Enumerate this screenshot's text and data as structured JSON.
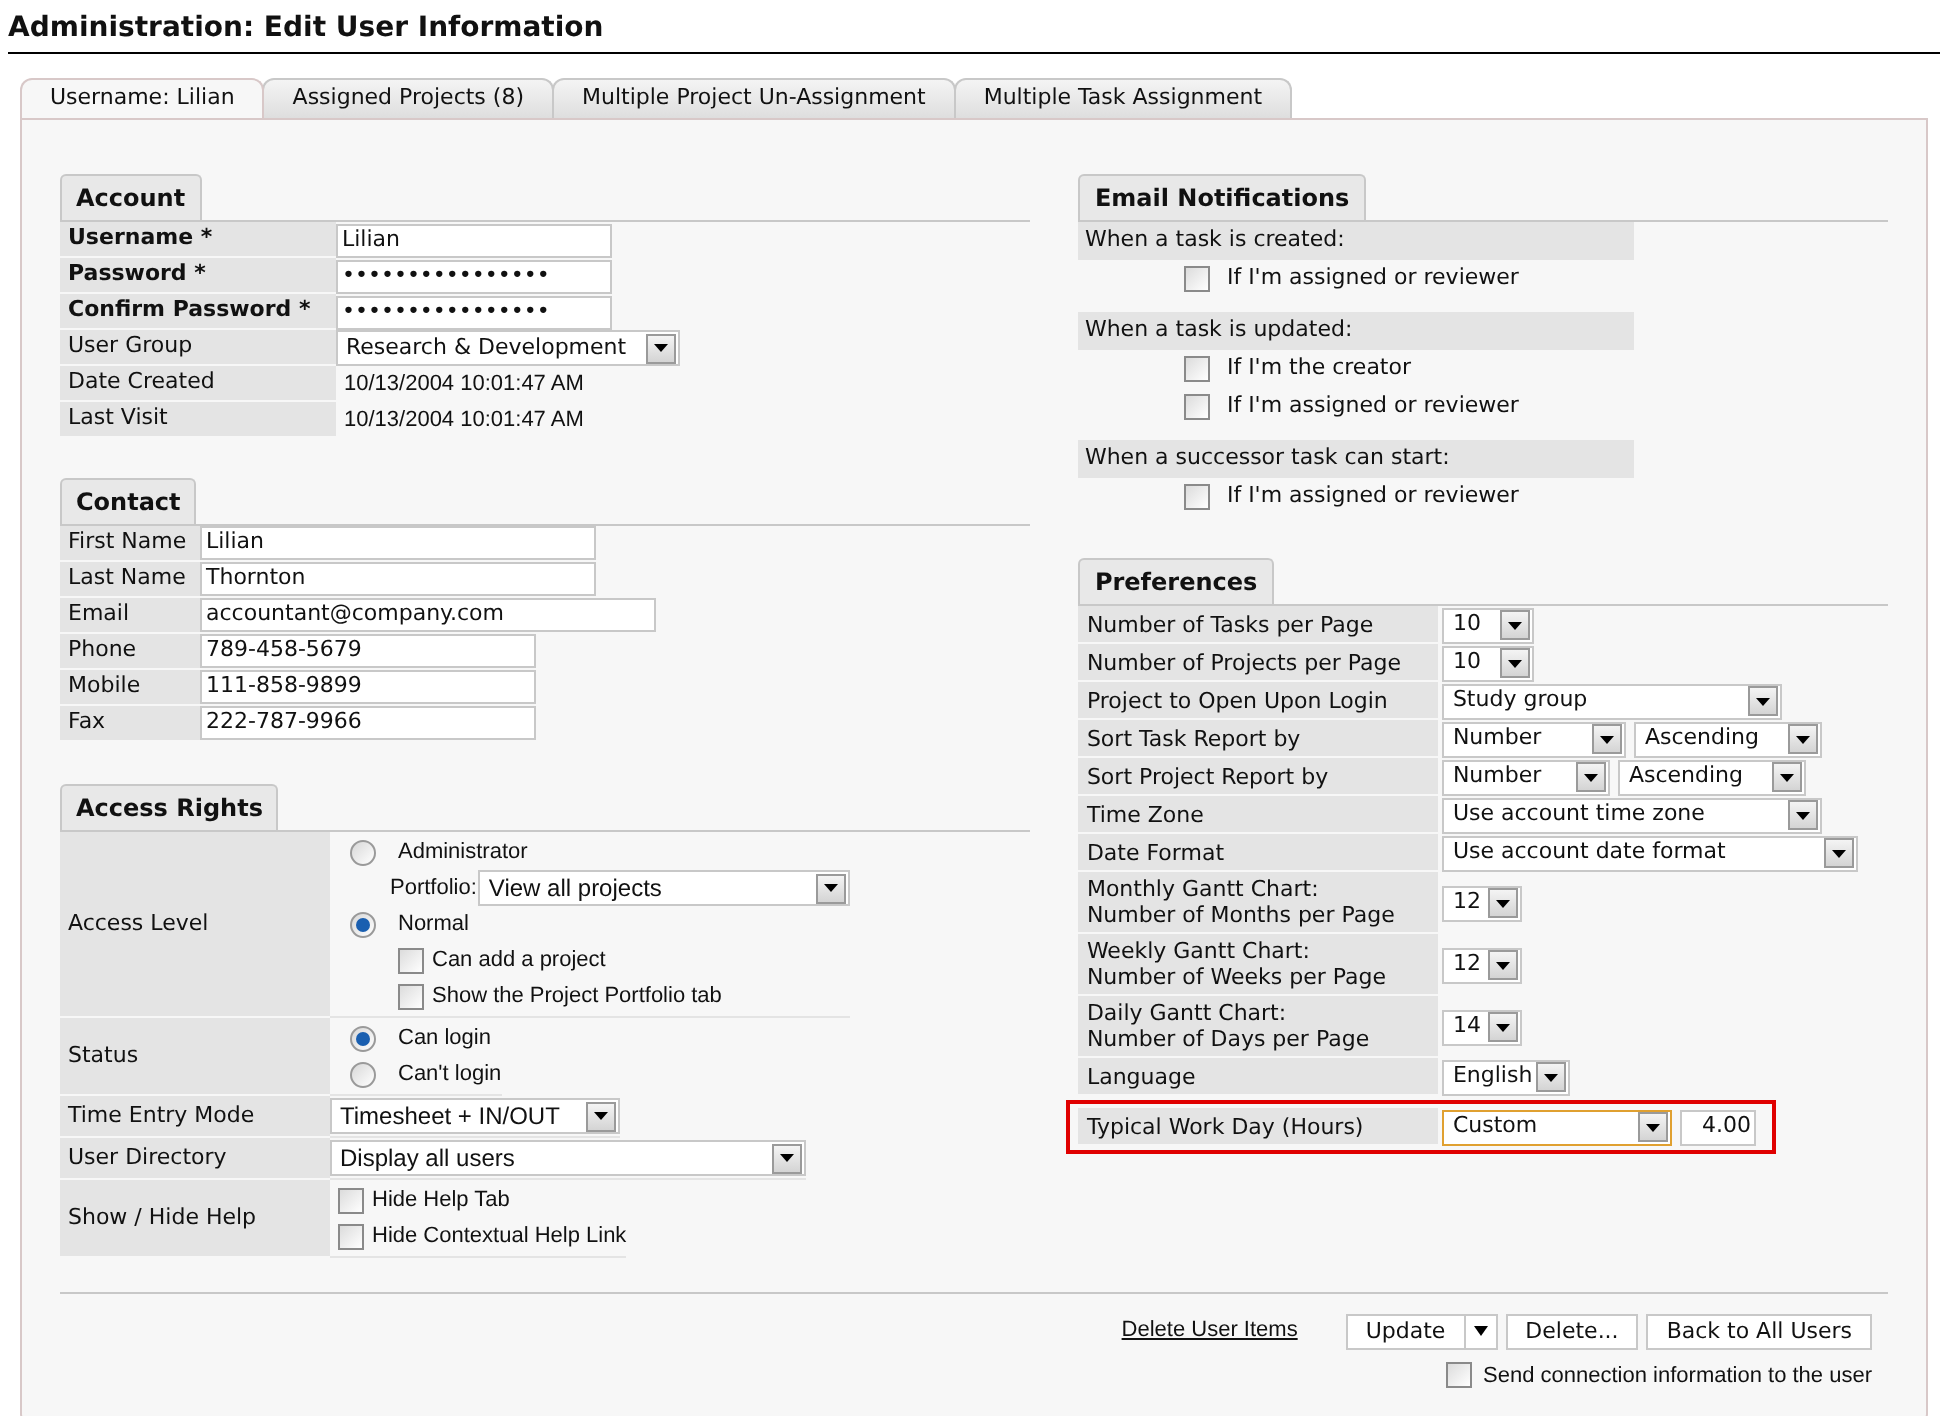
{
  "title": "Administration: Edit User Information",
  "tabs": [
    {
      "label": "Username: Lilian",
      "selected": true
    },
    {
      "label": "Assigned Projects (8)",
      "selected": false
    },
    {
      "label": "Multiple Project Un-Assignment",
      "selected": false
    },
    {
      "label": "Multiple Task Assignment",
      "selected": false
    }
  ],
  "account": {
    "heading": "Account",
    "rows": [
      {
        "label": "Username *",
        "required": true,
        "kind": "input",
        "value": "Lilian"
      },
      {
        "label": "Password *",
        "required": true,
        "kind": "input",
        "value": "••••••••••••••••"
      },
      {
        "label": "Confirm Password *",
        "required": true,
        "kind": "input",
        "value": "••••••••••••••••"
      },
      {
        "label": "User Group",
        "required": false,
        "kind": "select",
        "value": "Research & Development"
      },
      {
        "label": "Date Created",
        "required": false,
        "kind": "static",
        "value": "10/13/2004 10:01:47 AM"
      },
      {
        "label": "Last Visit",
        "required": false,
        "kind": "static",
        "value": "10/13/2004 10:01:47 AM"
      }
    ]
  },
  "contact": {
    "heading": "Contact",
    "rows": [
      {
        "label": "First Name",
        "value": "Lilian"
      },
      {
        "label": "Last Name",
        "value": "Thornton"
      },
      {
        "label": "Email",
        "value": "accountant@company.com"
      },
      {
        "label": "Phone",
        "value": "789-458-5679"
      },
      {
        "label": "Mobile",
        "value": "111-858-9899"
      },
      {
        "label": "Fax",
        "value": "222-787-9966"
      }
    ]
  },
  "access_rights": {
    "heading": "Access Rights",
    "rows": [
      {
        "label": "Access Level",
        "items": [
          {
            "kind": "radio",
            "label": "Administrator",
            "selected": false,
            "children": [
              {
                "kind": "labeled_select",
                "label": "Portfolio:",
                "value": "View all projects"
              }
            ]
          },
          {
            "kind": "radio",
            "label": "Normal",
            "selected": true,
            "children": [
              {
                "kind": "checkbox",
                "label": "Can add a project",
                "checked": false
              },
              {
                "kind": "checkbox",
                "label": "Show the Project Portfolio tab",
                "checked": false
              }
            ]
          }
        ]
      },
      {
        "label": "Status",
        "items": [
          {
            "kind": "radio",
            "label": "Can login",
            "selected": true
          },
          {
            "kind": "radio",
            "label": "Can't login",
            "selected": false
          }
        ]
      },
      {
        "label": "Time Entry Mode",
        "items": [
          {
            "kind": "select",
            "value": "Timesheet + IN/OUT"
          }
        ]
      },
      {
        "label": "User Directory",
        "items": [
          {
            "kind": "select",
            "value": "Display all users"
          }
        ]
      },
      {
        "label": "Show / Hide Help",
        "items": [
          {
            "kind": "checkbox",
            "label": "Hide Help Tab",
            "checked": false
          },
          {
            "kind": "checkbox",
            "label": "Hide Contextual Help Link",
            "checked": false
          }
        ]
      }
    ]
  },
  "email_notifications": {
    "heading": "Email Notifications",
    "groups": [
      {
        "title": "When a task is created:",
        "options": [
          {
            "label": "If I'm assigned or reviewer",
            "checked": false
          }
        ]
      },
      {
        "title": "When a task is updated:",
        "options": [
          {
            "label": "If I'm the creator",
            "checked": false
          },
          {
            "label": "If I'm assigned or reviewer",
            "checked": false
          }
        ]
      },
      {
        "title": "When a successor task can start:",
        "options": [
          {
            "label": "If I'm assigned or reviewer",
            "checked": false
          }
        ]
      }
    ]
  },
  "preferences": {
    "heading": "Preferences",
    "rows": [
      {
        "label": "Number of Tasks per Page",
        "highlighted": false,
        "controls": [
          {
            "kind": "select",
            "value": "10",
            "focused": false
          }
        ]
      },
      {
        "label": "Number of Projects per Page",
        "highlighted": false,
        "controls": [
          {
            "kind": "select",
            "value": "10",
            "focused": false
          }
        ]
      },
      {
        "label": "Project to Open Upon Login",
        "highlighted": false,
        "controls": [
          {
            "kind": "select",
            "value": "Study group",
            "focused": false
          }
        ]
      },
      {
        "label": "Sort Task Report by",
        "highlighted": false,
        "controls": [
          {
            "kind": "select",
            "value": "Number",
            "focused": false
          },
          {
            "kind": "select",
            "value": "Ascending",
            "focused": false
          }
        ]
      },
      {
        "label": "Sort Project Report by",
        "highlighted": false,
        "controls": [
          {
            "kind": "select",
            "value": "Number",
            "focused": false
          },
          {
            "kind": "select",
            "value": "Ascending",
            "focused": false
          }
        ]
      },
      {
        "label": "Time Zone",
        "highlighted": false,
        "controls": [
          {
            "kind": "select",
            "value": "Use account time zone",
            "focused": false
          }
        ]
      },
      {
        "label": "Date Format",
        "highlighted": false,
        "controls": [
          {
            "kind": "select",
            "value": "Use account date format",
            "focused": false
          }
        ]
      },
      {
        "label": "Monthly Gantt Chart:\nNumber of Months per Page",
        "highlighted": false,
        "controls": [
          {
            "kind": "select",
            "value": "12",
            "focused": false
          }
        ]
      },
      {
        "label": "Weekly Gantt Chart:\nNumber of Weeks per Page",
        "highlighted": false,
        "controls": [
          {
            "kind": "select",
            "value": "12",
            "focused": false
          }
        ]
      },
      {
        "label": "Daily Gantt Chart:\nNumber of Days per Page",
        "highlighted": false,
        "controls": [
          {
            "kind": "select",
            "value": "14",
            "focused": false
          }
        ]
      },
      {
        "label": "Language",
        "highlighted": false,
        "controls": [
          {
            "kind": "select",
            "value": "English",
            "focused": false
          }
        ]
      },
      {
        "label": "Typical Work Day (Hours)",
        "highlighted": true,
        "controls": [
          {
            "kind": "select",
            "value": "Custom",
            "focused": true
          },
          {
            "kind": "input",
            "value": "4.00"
          }
        ]
      }
    ]
  },
  "footer": {
    "link": "Delete User Items",
    "buttons": [
      {
        "label": "Update",
        "split": true
      },
      {
        "label": "Delete...",
        "split": false
      },
      {
        "label": "Back to All Users",
        "split": false
      }
    ],
    "send_info": {
      "label": "Send connection information to the user",
      "checked": false
    }
  }
}
